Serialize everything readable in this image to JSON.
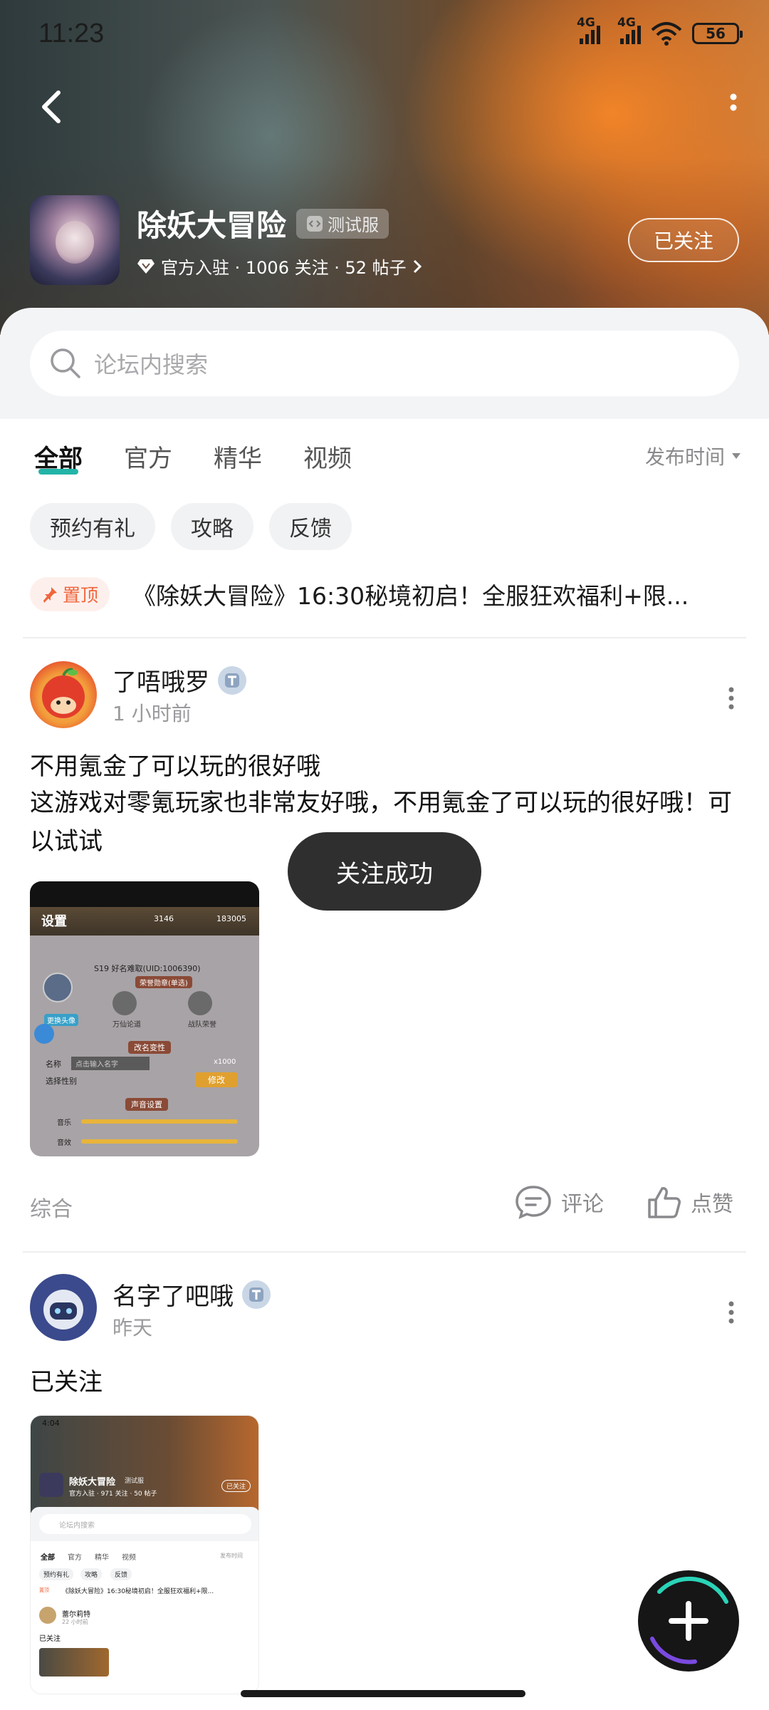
{
  "status_bar": {
    "time": "11:23",
    "net1": "4G",
    "net2": "4G",
    "battery": "56"
  },
  "forum": {
    "title": "除妖大冒险",
    "test_badge": "测试服",
    "meta": "官方入驻 · 1006 关注 · 52 帖子",
    "follow_button": "已关注"
  },
  "search": {
    "placeholder": "论坛内搜索"
  },
  "tabs": [
    {
      "label": "全部"
    },
    {
      "label": "官方"
    },
    {
      "label": "精华"
    },
    {
      "label": "视频"
    }
  ],
  "sort": {
    "label": "发布时间"
  },
  "chips": [
    {
      "label": "预约有礼"
    },
    {
      "label": "攻略"
    },
    {
      "label": "反馈"
    }
  ],
  "pinned": {
    "badge": "置顶",
    "text": "《除妖大冒险》16:30秘境初启！全服狂欢福利+限..."
  },
  "posts": [
    {
      "author": "了唔哦罗",
      "time": "1 小时前",
      "title": "不用氪金了可以玩的很好哦",
      "body": "这游戏对零氪玩家也非常友好哦，不用氪金了可以玩的很好哦！可以试试",
      "category": "综合",
      "comment_label": "评论",
      "like_label": "点赞",
      "image": {
        "header": "设置",
        "coin1": "3146",
        "coin2": "183005",
        "uid_line": "S19 好名难取(UID:1006390)",
        "honor_label": "荣誉勋章(单选)",
        "honor1": "万仙论道",
        "honor2": "战队荣誉",
        "change_avatar": "更换头像",
        "rename_title": "改名变性",
        "name_label": "名称",
        "name_placeholder": "点击输入名字",
        "cost": "x1000",
        "modify": "修改",
        "gender_label": "选择性别",
        "sound_title": "声音设置",
        "music": "音乐",
        "sfx": "音效"
      }
    },
    {
      "author": "名字了吧哦",
      "time": "昨天",
      "title": "已关注",
      "image": {
        "time": "4:04",
        "title": "除妖大冒险",
        "badge": "测试服",
        "meta": "官方入驻 · 971 关注 · 50 帖子",
        "follow": "已关注",
        "search": "论坛内搜索",
        "tabs": [
          "全部",
          "官方",
          "精华",
          "视频"
        ],
        "sort": "发布时间",
        "chips": [
          "预约有礼",
          "攻略",
          "反馈"
        ],
        "pinned_badge": "置顶",
        "pinned": "《除妖大冒险》16:30秘境初启！全服狂欢福利+限...",
        "author": "蕾尔莉特",
        "post_time": "22 小时前",
        "post_title": "已关注"
      }
    }
  ],
  "toast": {
    "text": "关注成功"
  },
  "colors": {
    "accent": "#22b4a8",
    "pin": "#f0653c",
    "toast_bg": "#2f2f2f"
  }
}
